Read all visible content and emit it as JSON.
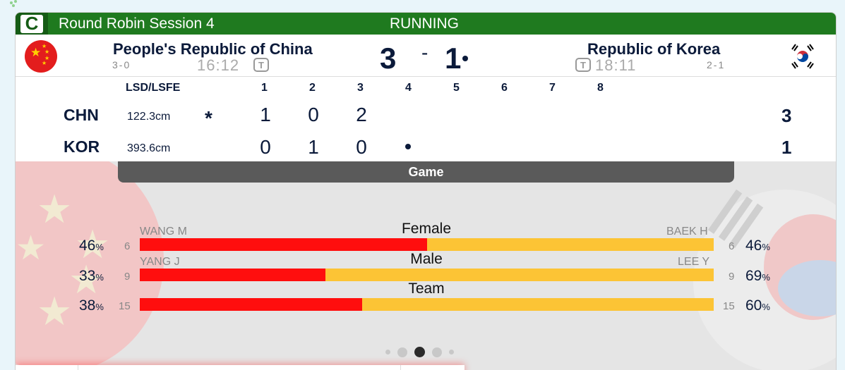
{
  "header": {
    "badge": "C",
    "session_title": "Round Robin Session 4",
    "status": "RUNNING"
  },
  "home": {
    "name": "People's Republic of China",
    "record": "3-0",
    "clock": "16:12",
    "score": "3",
    "abbr": "CHN",
    "lsd": "122.3cm",
    "total": "3"
  },
  "away": {
    "name": "Republic of Korea",
    "record": "2-1",
    "clock": "18:11",
    "score": "1",
    "abbr": "KOR",
    "lsd": "393.6cm",
    "total": "1"
  },
  "score_dash": "-",
  "timeout_icon": "T",
  "linescore": {
    "lsd_header": "LSD/LSFE",
    "ends": [
      "1",
      "2",
      "3",
      "4",
      "5",
      "6",
      "7",
      "8"
    ],
    "home_ends": [
      "1",
      "0",
      "2"
    ],
    "away_ends": [
      "0",
      "1",
      "0"
    ],
    "hammer_icon": "*"
  },
  "game_tab": "Game",
  "stats": [
    {
      "label": "Female",
      "home_player": "WANG M",
      "away_player": "BAEK H",
      "home_pct": "46",
      "away_pct": "46",
      "home_shots": "6",
      "away_shots": "6",
      "home_share": 0.5
    },
    {
      "label": "Male",
      "home_player": "YANG J",
      "away_player": "LEE Y",
      "home_pct": "33",
      "away_pct": "69",
      "home_shots": "9",
      "away_shots": "9",
      "home_share": 0.323
    },
    {
      "label": "Team",
      "home_player": "",
      "away_player": "",
      "home_pct": "38",
      "away_pct": "60",
      "home_shots": "15",
      "away_shots": "15",
      "home_share": 0.388
    }
  ],
  "pct_sign": "%",
  "colors": {
    "header_green": "#1f7a1f",
    "home_bar": "#ff0e0e",
    "away_bar": "#fcc435",
    "navy": "#0b1a3a"
  },
  "icons": {
    "home_flag": "china-flag-icon",
    "away_flag": "korea-flag-icon",
    "timeout": "timeout-icon",
    "hammer": "hammer-icon"
  }
}
